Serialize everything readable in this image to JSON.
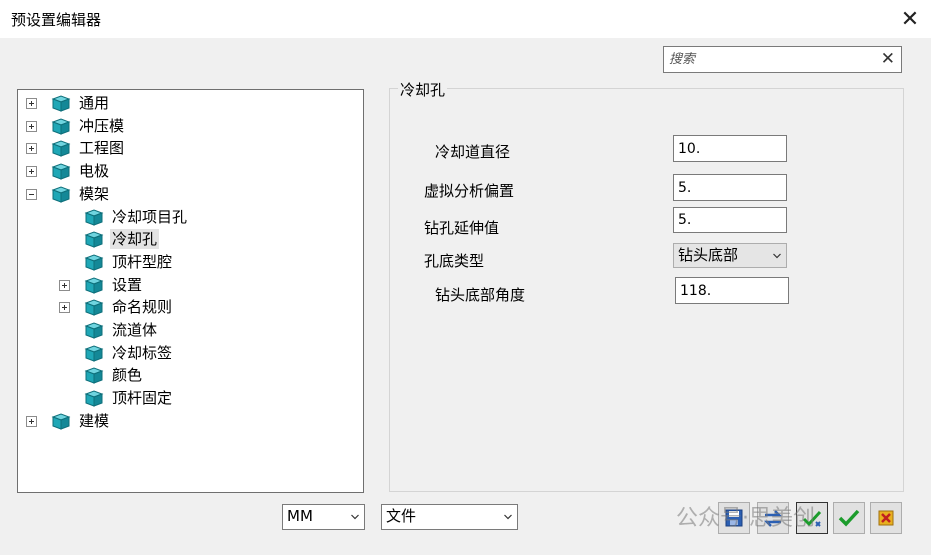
{
  "window": {
    "title": "预设置编辑器"
  },
  "search": {
    "placeholder": "搜索",
    "value": ""
  },
  "tree": {
    "items": [
      {
        "label": "通用",
        "expander": "plus",
        "level": 0
      },
      {
        "label": "冲压模",
        "expander": "plus",
        "level": 0
      },
      {
        "label": "工程图",
        "expander": "plus",
        "level": 0
      },
      {
        "label": "电极",
        "expander": "plus",
        "level": 0
      },
      {
        "label": "模架",
        "expander": "minus",
        "level": 0
      },
      {
        "label": "冷却项目孔",
        "expander": "none",
        "level": 1
      },
      {
        "label": "冷却孔",
        "expander": "none",
        "level": 1,
        "selected": true
      },
      {
        "label": "顶杆型腔",
        "expander": "none",
        "level": 1
      },
      {
        "label": "设置",
        "expander": "plus",
        "level": 1
      },
      {
        "label": "命名规则",
        "expander": "plus",
        "level": 1
      },
      {
        "label": "流道体",
        "expander": "none",
        "level": 1
      },
      {
        "label": "冷却标签",
        "expander": "none",
        "level": 1
      },
      {
        "label": "颜色",
        "expander": "none",
        "level": 1
      },
      {
        "label": "顶杆固定",
        "expander": "none",
        "level": 1
      },
      {
        "label": "建模",
        "expander": "plus",
        "level": 0
      }
    ]
  },
  "panel": {
    "title": "冷却孔",
    "fields": {
      "channel_diameter": {
        "label": "冷却道直径",
        "value": "10."
      },
      "virtual_offset": {
        "label": "虚拟分析偏置",
        "value": "5."
      },
      "drill_extension": {
        "label": "钻孔延伸值",
        "value": "5."
      },
      "hole_bottom_type": {
        "label": "孔底类型",
        "value": "钻头底部"
      },
      "drill_tip_angle": {
        "label": "钻头底部角度",
        "value": "118."
      }
    }
  },
  "bottom": {
    "unit_select": "MM",
    "file_select": "文件"
  },
  "watermark": {
    "text": "公众号·思美创"
  },
  "colors": {
    "icon_teal": "#1fa7b6",
    "icon_teal_dark": "#0e6f7a",
    "check_green": "#1c9c2c"
  }
}
